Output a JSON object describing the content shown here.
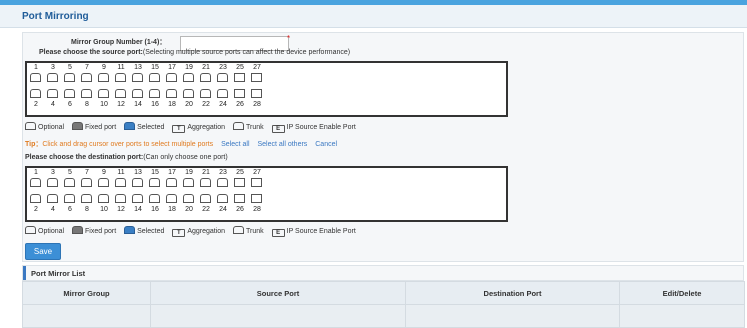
{
  "page": {
    "title": "Port Mirroring"
  },
  "form": {
    "mirror_group_label": "Mirror Group Number (1-4)：",
    "mirror_group_value": "",
    "required_mark": "*",
    "source_prompt_bold": "Please choose the source port:",
    "source_prompt_note": "(Selecting multiple source ports can affect the device performance)",
    "dest_prompt_bold": "Please choose the destination port:",
    "dest_prompt_note": "(Can only choose one port)",
    "save_label": "Save"
  },
  "ports": {
    "top_row": [
      "1",
      "3",
      "5",
      "7",
      "9",
      "11",
      "13",
      "15",
      "17",
      "19",
      "21",
      "23",
      "25",
      "27"
    ],
    "bottom_row": [
      "2",
      "4",
      "6",
      "8",
      "10",
      "12",
      "14",
      "16",
      "18",
      "20",
      "22",
      "24",
      "26",
      "28"
    ]
  },
  "legend": {
    "optional": "Optional",
    "fixed": "Fixed port",
    "selected": "Selected",
    "aggregation": "Aggregation",
    "trunk": "Trunk",
    "ip_source": "IP Source Enable Port",
    "agg_glyph": "T",
    "ip_glyph": "E"
  },
  "tips": {
    "label": "Tip：",
    "text": "Click and drag cursor over ports to select multiple ports",
    "select_all": "Select all",
    "select_others": "Select all others",
    "cancel": "Cancel"
  },
  "mirror_list": {
    "title": "Port Mirror List",
    "columns": [
      "Mirror Group",
      "Source Port",
      "Destination Port",
      "Edit/Delete"
    ]
  },
  "colors": {
    "accent": "#3a78c2",
    "header_bar": "#4aa3df",
    "tip": "#e07b20",
    "required": "#e02020"
  }
}
